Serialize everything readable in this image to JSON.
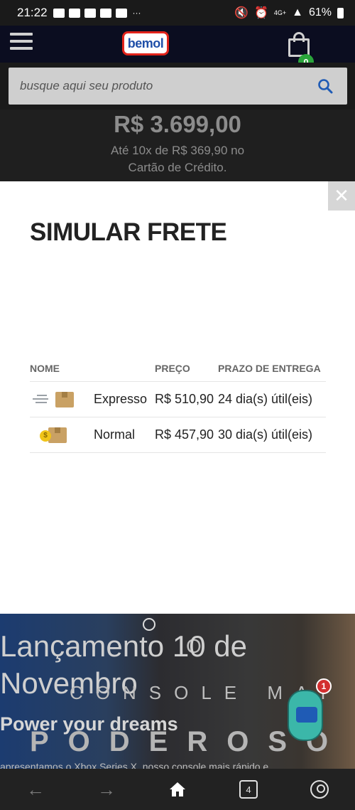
{
  "status_bar": {
    "time": "21:22",
    "more": "···",
    "network": "4G+",
    "battery": "61%"
  },
  "header": {
    "logo_text": "bemol",
    "cart_count": "0"
  },
  "search": {
    "placeholder": "busque aqui seu produto"
  },
  "product": {
    "price": "R$ 3.699,00",
    "installments_line1": "Até 10x de R$ 369,90 no",
    "installments_line2": "Cartão de Crédito."
  },
  "modal": {
    "close_label": "✕",
    "title": "SIMULAR FRETE",
    "table": {
      "headers": {
        "name": "NOME",
        "price": "PREÇO",
        "deadline": "PRAZO DE ENTREGA"
      },
      "rows": [
        {
          "icon": "express-delivery-icon",
          "name": "Expresso",
          "price": "R$ 510,90",
          "deadline": "24 dia(s) útil(eis)"
        },
        {
          "icon": "normal-delivery-icon",
          "name": "Normal",
          "price": "R$ 457,90",
          "deadline": "30 dia(s) útil(eis)"
        }
      ]
    }
  },
  "promo": {
    "title": "Lançamento 10 de Novembro",
    "console_text": "CONSOLE MAI",
    "subtitle": "Power your dreams",
    "poderoso": "PODEROSO",
    "footer": "apresentamos o Xbox Series X, nosso console mais rápido e"
  },
  "chatbot": {
    "badge": "1"
  },
  "navbar": {
    "tabs_count": "4"
  }
}
